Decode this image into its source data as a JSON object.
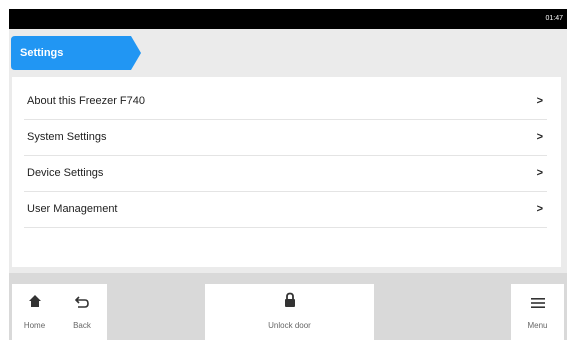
{
  "status_bar": {
    "time": "01:47"
  },
  "breadcrumb": {
    "label": "Settings",
    "color": "#2196f3"
  },
  "menu": {
    "items": [
      {
        "label": "About this Freezer F740",
        "chevron": ">"
      },
      {
        "label": "System Settings",
        "chevron": ">"
      },
      {
        "label": "Device Settings",
        "chevron": ">"
      },
      {
        "label": "User Management",
        "chevron": ">"
      }
    ]
  },
  "bottom_nav": {
    "home": {
      "label": "Home",
      "icon": "home-icon"
    },
    "back": {
      "label": "Back",
      "icon": "back-arrow-icon"
    },
    "unlock": {
      "label": "Unlock door",
      "icon": "padlock-icon"
    },
    "menu": {
      "label": "Menu",
      "icon": "hamburger-menu-icon"
    }
  }
}
